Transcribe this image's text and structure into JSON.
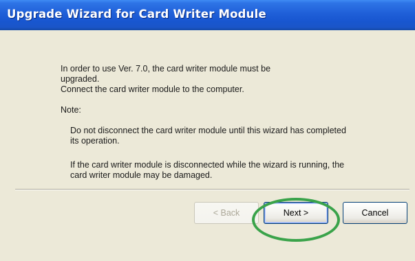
{
  "window": {
    "title": "Upgrade Wizard for Card Writer Module"
  },
  "body": {
    "intro_line1": "In order to use Ver. 7.0, the card writer module must be",
    "intro_line2": "upgraded.",
    "intro_line3": "Connect the card writer module to the computer.",
    "note_label": "Note:",
    "note1_line1": "Do not disconnect the card writer module until this wizard has completed",
    "note1_line2": "its operation.",
    "note2_line1": "If the card writer module is disconnected while the wizard is running, the",
    "note2_line2": "card writer module may be damaged."
  },
  "buttons": {
    "back_label": "< Back",
    "next_label": "Next >",
    "cancel_label": "Cancel"
  },
  "annotation": {
    "highlight_color": "#3aa34a"
  }
}
